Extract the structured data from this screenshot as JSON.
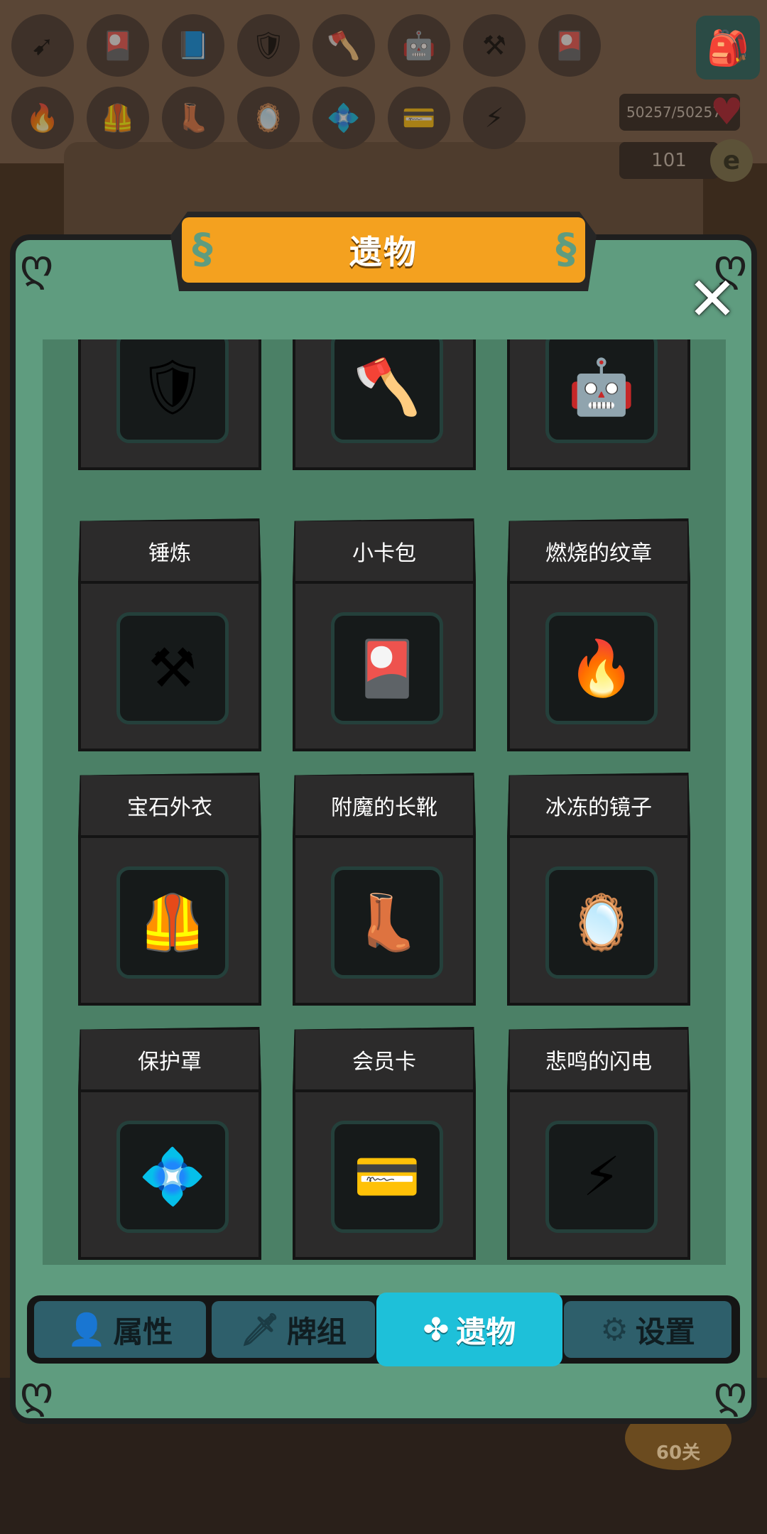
{
  "header": {
    "hp": "50257/50257",
    "gold": "101"
  },
  "background_relic_icons": [
    "arrow-relic-icon",
    "card-pack-icon",
    "tome-icon",
    "shield-g-icon",
    "axe-icon",
    "robot-icon",
    "anvil-icon",
    "card-pack-icon",
    "burning-badge-icon",
    "gem-coat-icon",
    "boots-icon",
    "mirror-icon",
    "barrier-icon",
    "member-card-icon",
    "lightning-icon"
  ],
  "modal": {
    "title": "遗物",
    "close_glyph": "✕"
  },
  "relics": [
    {
      "name": "",
      "icon": "shield-g-icon",
      "glyph": "🛡"
    },
    {
      "name": "",
      "icon": "axe-icon",
      "glyph": "🪓"
    },
    {
      "name": "",
      "icon": "robot-icon",
      "glyph": "🤖"
    },
    {
      "name": "锤炼",
      "icon": "anvil-icon",
      "glyph": "⚒"
    },
    {
      "name": "小卡包",
      "icon": "card-pack-icon",
      "glyph": "🎴"
    },
    {
      "name": "燃烧的纹章",
      "icon": "burning-badge-icon",
      "glyph": "🔥"
    },
    {
      "name": "宝石外衣",
      "icon": "gem-coat-icon",
      "glyph": "🦺"
    },
    {
      "name": "附魔的长靴",
      "icon": "boots-icon",
      "glyph": "👢"
    },
    {
      "name": "冰冻的镜子",
      "icon": "mirror-icon",
      "glyph": "🪞"
    },
    {
      "name": "保护罩",
      "icon": "barrier-icon",
      "glyph": "💠"
    },
    {
      "name": "会员卡",
      "icon": "member-card-icon",
      "glyph": "💳"
    },
    {
      "name": "悲鸣的闪电",
      "icon": "lightning-icon",
      "glyph": "⚡"
    }
  ],
  "tabs": [
    {
      "label": "属性",
      "icon": "person-icon",
      "glyph": "👤",
      "active": false
    },
    {
      "label": "牌组",
      "icon": "sword-icon",
      "glyph": "🗡",
      "active": false
    },
    {
      "label": "遗物",
      "icon": "clover-icon",
      "glyph": "✤",
      "active": true
    },
    {
      "label": "设置",
      "icon": "gear-icon",
      "glyph": "⚙",
      "active": false
    }
  ],
  "level_badge": "60关",
  "colors": {
    "modal_green": "#5f9c7f",
    "banner_orange": "#f4a11f",
    "tab_active": "#1ec0d9",
    "tab_inactive": "#2e5f6b"
  }
}
